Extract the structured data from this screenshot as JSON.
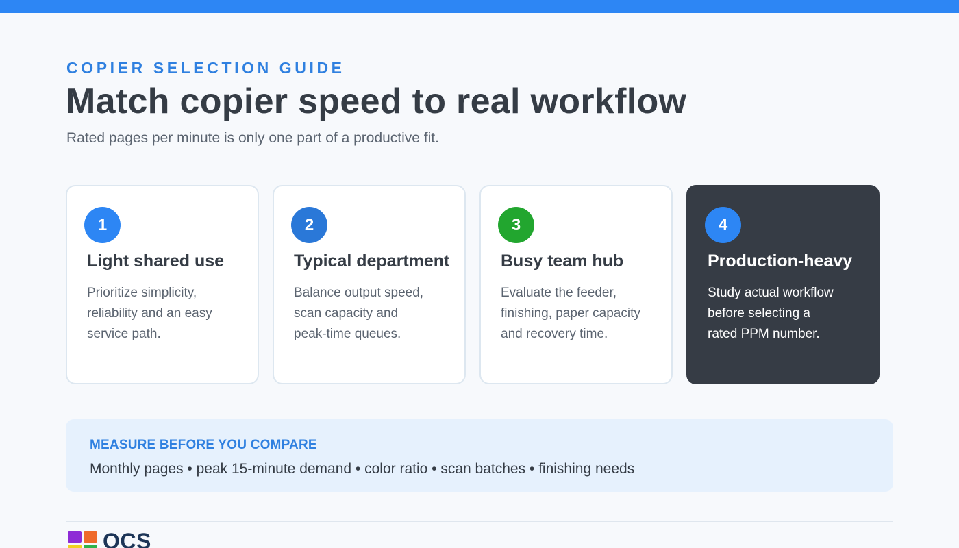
{
  "header": {
    "eyebrow": "COPIER SELECTION GUIDE",
    "title": "Match copier speed to real workflow",
    "subtitle": "Rated pages per minute is only one part of a productive fit."
  },
  "cards": [
    {
      "number": "1",
      "title": "Light shared use",
      "lines": [
        "Prioritize simplicity,",
        "reliability and an easy",
        "service path."
      ],
      "badge_color": "#2d86f4"
    },
    {
      "number": "2",
      "title": "Typical department",
      "lines": [
        "Balance output speed,",
        "scan capacity and",
        "peak-time queues."
      ],
      "badge_color": "#2a78d8"
    },
    {
      "number": "3",
      "title": "Busy team hub",
      "lines": [
        "Evaluate the feeder,",
        "finishing, paper capacity",
        "and recovery time."
      ],
      "badge_color": "#22a62f"
    },
    {
      "number": "4",
      "title": "Production-heavy",
      "lines": [
        "Study actual workflow",
        "before selecting a",
        "rated PPM number."
      ],
      "badge_color": "#2d86f4"
    }
  ],
  "measure": {
    "label": "MEASURE BEFORE YOU COMPARE",
    "text": "Monthly pages • peak 15-minute demand • color ratio • scan batches • finishing needs"
  },
  "footer": {
    "logo_text": "OCS",
    "logo_icon": "colored-squares-logo"
  },
  "colors": {
    "accent": "#2d86f4",
    "dark_card": "#363c45",
    "green": "#22a62f"
  }
}
